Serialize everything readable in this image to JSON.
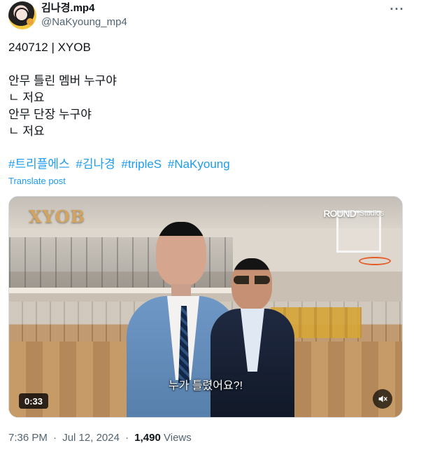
{
  "tweet": {
    "author": {
      "display_name": "김나경.mp4",
      "handle": "@NaKyoung_mp4"
    },
    "menu_label": "···",
    "text": "240712 | XYOB\n\n안무 틀린 멤버 누구야\nㄴ 저요\n안무 단장 누구야\nㄴ 저요",
    "hashtags": [
      "#트리플에스",
      "#김나경",
      "#tripleS",
      "#NaKyoung"
    ],
    "translate_label": "Translate post",
    "media": {
      "brand_logo": "XYOB",
      "studio_mark": "ROUND",
      "studio_suffix": "Studios",
      "subtitle": "누가 틀렸어요?!",
      "duration": "0:33",
      "mute_icon": "speaker-muted-icon"
    },
    "footer": {
      "time": "7:36 PM",
      "date": "Jul 12, 2024",
      "views_count": "1,490",
      "views_label": "Views"
    }
  },
  "colors": {
    "text": "#0f1419",
    "muted": "#536471",
    "link": "#1d9bf0"
  }
}
